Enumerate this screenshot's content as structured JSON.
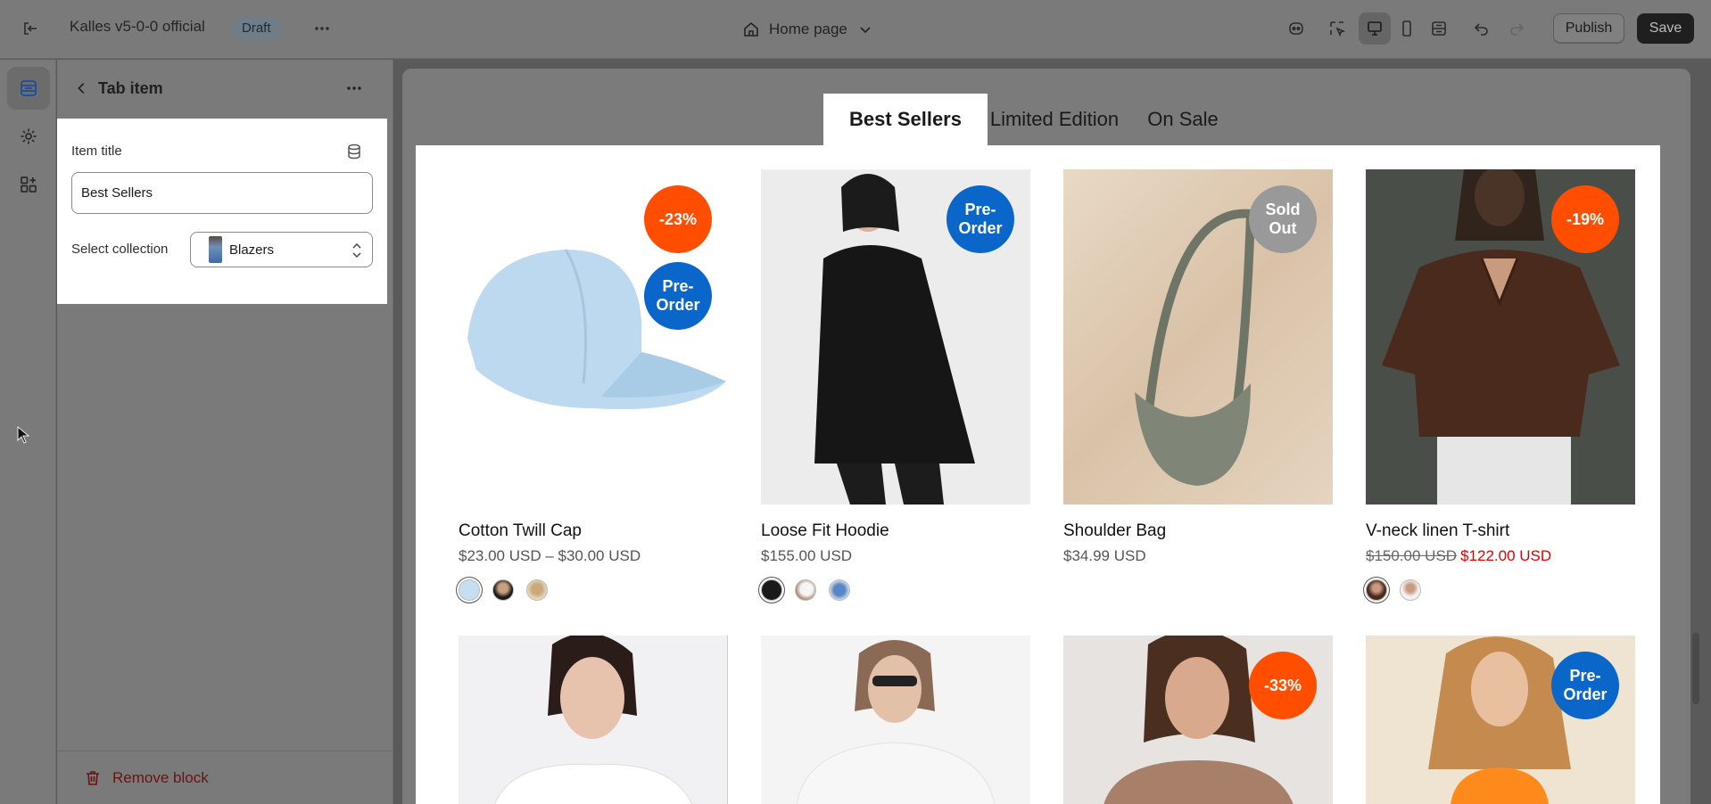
{
  "topbar": {
    "store_name": "Kalles v5-0-0 official",
    "status_badge": "Draft",
    "page_selector": "Home page",
    "publish_label": "Publish",
    "save_label": "Save"
  },
  "panel": {
    "title": "Tab item",
    "item_title_label": "Item title",
    "item_title_value": "Best Sellers",
    "select_collection_label": "Select collection",
    "collection_value": "Blazers",
    "remove_block_label": "Remove block"
  },
  "preview": {
    "tabs": [
      {
        "label": "Best Sellers",
        "active": true
      },
      {
        "label": "Limited Edition",
        "active": false
      },
      {
        "label": "On Sale",
        "active": false
      }
    ],
    "products": [
      {
        "name": "Cotton Twill Cap",
        "price": "$23.00 USD – $30.00 USD",
        "badges": [
          "-23%",
          "Pre-Order"
        ]
      },
      {
        "name": "Loose Fit Hoodie",
        "price": "$155.00 USD",
        "badges": [
          "Pre-Order"
        ]
      },
      {
        "name": "Shoulder Bag",
        "price": "$34.99 USD",
        "badges": [
          "Sold Out"
        ]
      },
      {
        "name": "V-neck linen T-shirt",
        "old_price": "$150.00 USD",
        "new_price": "$122.00 USD",
        "badges": [
          "-19%"
        ]
      }
    ],
    "row2_badges": [
      "-33%",
      "Pre-Order"
    ]
  },
  "colors": {
    "sale_badge": "#ff4e00",
    "preorder_badge": "#0a67c9",
    "soldout_badge": "#999999",
    "sale_price": "#e00000"
  }
}
